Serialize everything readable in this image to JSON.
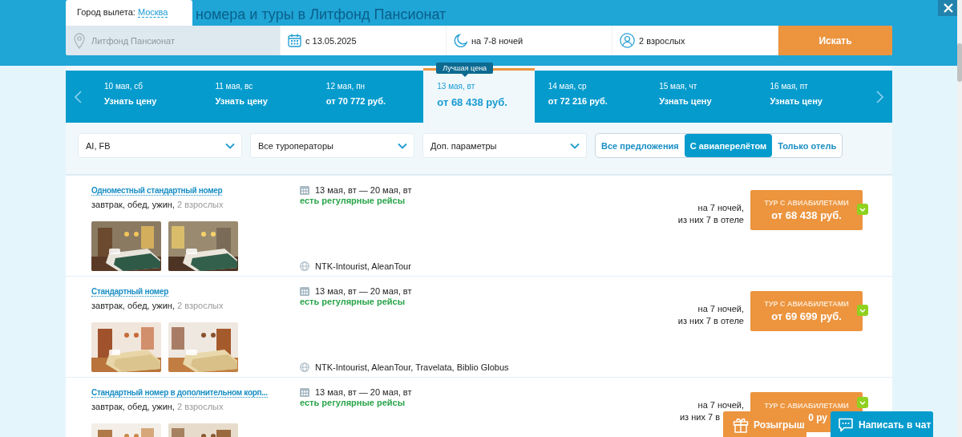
{
  "header": {
    "departure_label": "Город вылета:",
    "departure_city": "Москва",
    "title": "номера и туры в Литфонд Пансионат"
  },
  "search": {
    "location": {
      "value": "Литфонд Пансионат",
      "disabled": true
    },
    "date": "с 13.05.2025",
    "nights": "на 7-8 ночей",
    "guests": "2 взрослых",
    "button": "Искать"
  },
  "dates": [
    {
      "date": "10 мая, сб",
      "price": "Узнать цену",
      "selected": false
    },
    {
      "date": "11 мая, вс",
      "price": "Узнать цену",
      "selected": false
    },
    {
      "date": "12 мая, пн",
      "price": "от 70 772 руб.",
      "selected": false
    },
    {
      "date": "13 мая, вт",
      "price": "от 68 438 руб.",
      "selected": true,
      "badge": "Лучшая цена"
    },
    {
      "date": "14 мая, ср",
      "price": "от 72 216 руб.",
      "selected": false
    },
    {
      "date": "15 мая, чт",
      "price": "Узнать цену",
      "selected": false
    },
    {
      "date": "16 мая, пт",
      "price": "Узнать цену",
      "selected": false
    }
  ],
  "filters": {
    "dropdowns": [
      "AI, FB",
      "Все туроператоры",
      "Доп. параметры"
    ],
    "segments": [
      {
        "label": "Все предложения",
        "selected": false
      },
      {
        "label": "С авиаперелётом",
        "selected": true
      },
      {
        "label": "Только отель",
        "selected": false
      }
    ]
  },
  "offers": [
    {
      "title": "Одноместный стандартный номер",
      "meals": "завтрак, обед, ужин,",
      "guests": "2 взрослых",
      "dates": "13 мая, вт — 20 мая, вт",
      "flights": "есть регулярные рейсы",
      "operators": "NTK-Intourist, AleanTour",
      "nights": "на 7 ночей,",
      "nights_hotel": "из них 7 в отеле",
      "button_label": "ТУР С АВИАБИЛЕТАМИ",
      "price": "от 68 438 руб.",
      "verified": true,
      "cut_off": false
    },
    {
      "title": "Стандартный номер",
      "meals": "завтрак, обед, ужин,",
      "guests": "2 взрослых",
      "dates": "13 мая, вт — 20 мая, вт",
      "flights": "есть регулярные рейсы",
      "operators": "NTK-Intourist, AleanTour, Travelata, Biblio Globus",
      "nights": "на 7 ночей,",
      "nights_hotel": "из них 7 в отеле",
      "button_label": "ТУР С АВИАБИЛЕТАМИ",
      "price": "от 69 699 руб.",
      "verified": true,
      "cut_off": false
    },
    {
      "title": "Стандартный номер в дополнительном корп...",
      "meals": "завтрак, обед, ужин,",
      "guests": "2 взрослых",
      "dates": "13 мая, вт — 20 мая, вт",
      "flights": "есть регулярные рейсы",
      "nights": "на 7 ночей,",
      "nights_hotel": "из них 7 в",
      "button_label": "ТУР С АВИАБИЛЕТАМИ",
      "price": "0 ру",
      "verified": true,
      "cut_off": true
    }
  ],
  "floating": {
    "prize": "Розыгрыш",
    "chat": "Написать в чат"
  }
}
